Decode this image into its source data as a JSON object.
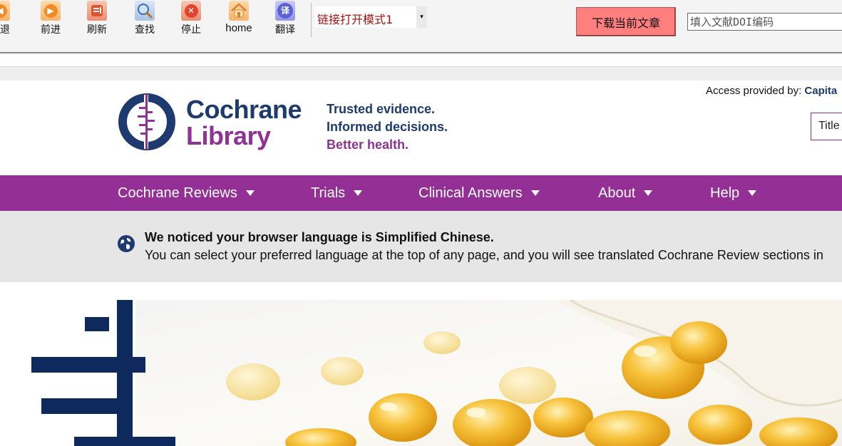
{
  "toolbar": {
    "buttons": [
      {
        "label": "后退",
        "icon": "back-arrow-icon"
      },
      {
        "label": "前进",
        "icon": "forward-arrow-icon"
      },
      {
        "label": "刷新",
        "icon": "refresh-icon"
      },
      {
        "label": "查找",
        "icon": "magnifier-icon"
      },
      {
        "label": "停止",
        "icon": "stop-icon"
      },
      {
        "label": "home",
        "icon": "home-icon"
      },
      {
        "label": "翻译",
        "icon": "translate-icon"
      }
    ],
    "mode_select": "链接打开模式1",
    "download_label": "下载当前文章",
    "doi_placeholder": "填入文献DOI编码"
  },
  "header": {
    "logo_line1": "Cochrane",
    "logo_line2": "Library",
    "tagline": [
      "Trusted evidence.",
      "Informed decisions.",
      "Better health."
    ],
    "access_label": "Access provided by:",
    "access_value": "Capita",
    "search_scope": "Title"
  },
  "nav": {
    "items": [
      "Cochrane Reviews",
      "Trials",
      "Clinical Answers",
      "About",
      "Help"
    ]
  },
  "notice": {
    "title": "We noticed your browser language is Simplified Chinese.",
    "body": "You can select your preferred language at the top of any page, and you will see translated Cochrane Review sections in"
  },
  "colors": {
    "brand_navy": "#1e3a6e",
    "brand_purple": "#942f95",
    "download_button": "#ff7f7f",
    "notice_bg": "#e6e6e6"
  }
}
